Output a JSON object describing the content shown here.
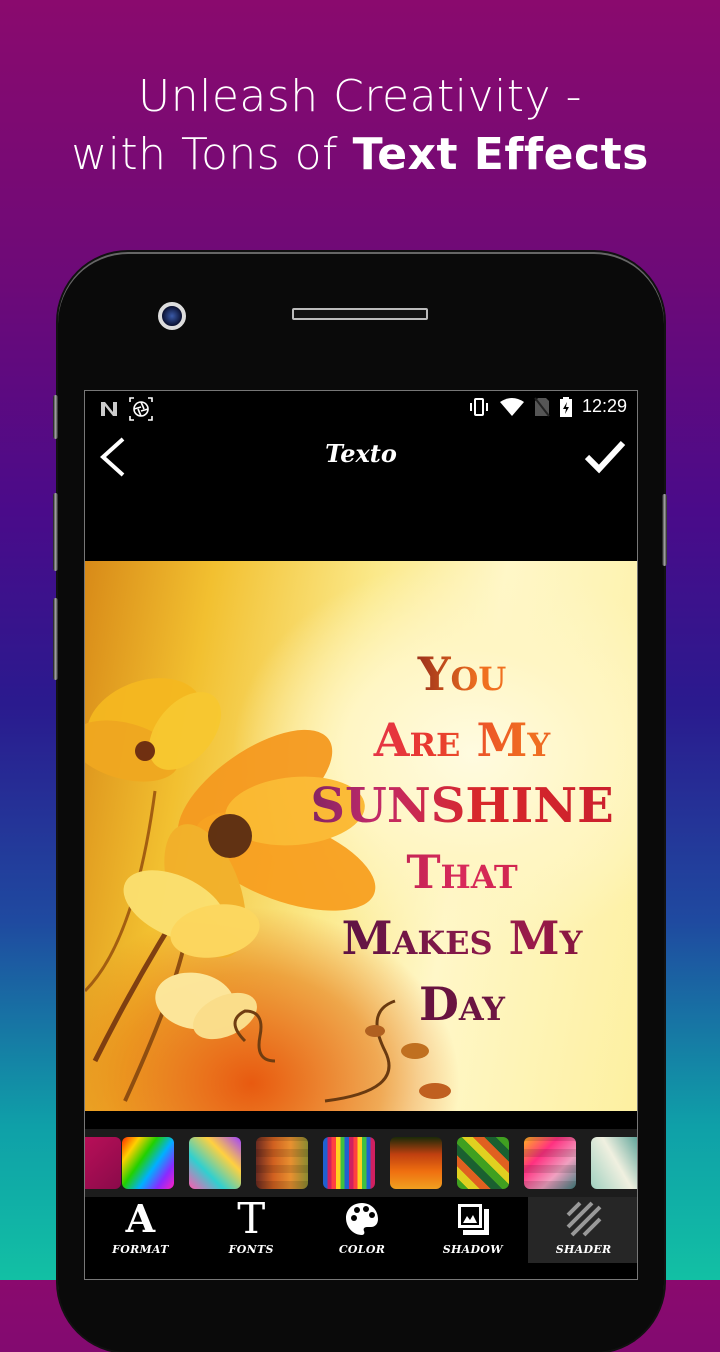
{
  "promo": {
    "line1": "Unleash Creativity -",
    "line2_prefix": "with Tons of ",
    "line2_bold": "Text Effects"
  },
  "status_bar": {
    "left_icons": [
      "n-notification-icon",
      "screenshot-icon"
    ],
    "right_icons": [
      "vibrate-icon",
      "wifi-icon",
      "no-sim-icon",
      "battery-charging-icon"
    ],
    "time": "12:29"
  },
  "app_bar": {
    "title": "Texto",
    "back_icon": "chevron-left-icon",
    "confirm_icon": "checkmark-icon"
  },
  "canvas": {
    "quote_lines": [
      "You",
      "Are My",
      "SUNSHINE",
      "That",
      "Makes My",
      "Day"
    ]
  },
  "shader_swatches": [
    {
      "name": "pink-sparkle",
      "colors": [
        "#c0105a",
        "#8a0a4a"
      ]
    },
    {
      "name": "rainbow-diagonal",
      "colors": [
        "#ff2a00",
        "#ffd000",
        "#22d000",
        "#00b0ff",
        "#8a2aff",
        "#ff20c0"
      ]
    },
    {
      "name": "psychedelic-swirl",
      "colors": [
        "#ff5ab0",
        "#30d0d0",
        "#ffd040",
        "#a040ff"
      ]
    },
    {
      "name": "warm-plaid",
      "colors": [
        "#6a2a20",
        "#d06020",
        "#e89030",
        "#8a8a30"
      ]
    },
    {
      "name": "rainbow-stripes",
      "colors": [
        "#2060d0",
        "#d02060",
        "#ff4040",
        "#ffd020",
        "#40c040"
      ]
    },
    {
      "name": "lava-gradient",
      "colors": [
        "#1a2a08",
        "#c04010",
        "#f07010",
        "#f0a020"
      ]
    },
    {
      "name": "green-diamonds",
      "colors": [
        "#40a020",
        "#e0d020",
        "#e06020",
        "#1a6030"
      ]
    },
    {
      "name": "pink-pixels",
      "colors": [
        "#ffb020",
        "#ff3080",
        "#f0a0c0",
        "#408080"
      ]
    },
    {
      "name": "teal-marble",
      "colors": [
        "#a0d0c0",
        "#f0f0e0",
        "#4a9a90"
      ]
    }
  ],
  "toolbar": {
    "items": [
      {
        "label": "FORMAT",
        "icon": "letter-a-icon",
        "active": false
      },
      {
        "label": "FONTS",
        "icon": "letter-t-icon",
        "active": false
      },
      {
        "label": "COLOR",
        "icon": "palette-icon",
        "active": false
      },
      {
        "label": "SHADOW",
        "icon": "shadow-image-icon",
        "active": false
      },
      {
        "label": "SHADER",
        "icon": "hatch-stripes-icon",
        "active": true
      }
    ]
  }
}
